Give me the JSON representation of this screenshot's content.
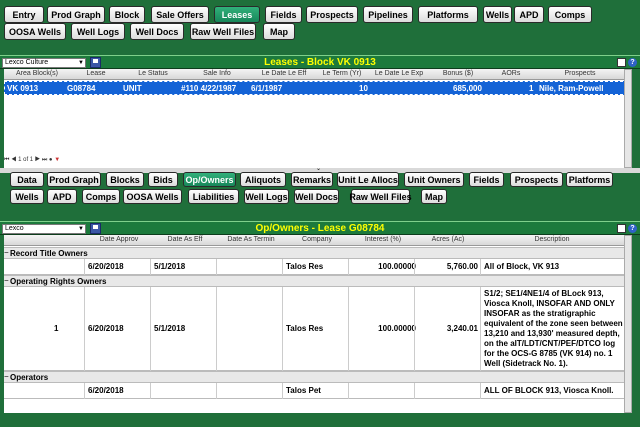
{
  "top_nav": [
    "Entry",
    "Prod Graph",
    "Block",
    "Sale Offers",
    "Leases",
    "Fields",
    "Prospects",
    "Pipelines",
    "Platforms",
    "Wells",
    "APD",
    "Comps",
    "OOSA Wells",
    "Well Logs",
    "Well Docs",
    "Raw Well Files",
    "Map"
  ],
  "top_active": "Leases",
  "leases_panel": {
    "selector": "Lexco Culture",
    "title": "Leases - Block VK 0913",
    "columns": [
      "Area Block(s)",
      "Lease",
      "Le Status",
      "Sale Info",
      "Le Date Le Eff",
      "Le Term (Yr)",
      "Le Date Le Exp",
      "Bonus ($)",
      "AORs",
      "Prospects"
    ],
    "row": {
      "area_block": "VK 0913",
      "lease": "G08784",
      "status": "UNIT",
      "sale_info": "#110 4/22/1987",
      "date_eff": "6/1/1987",
      "term": "10",
      "date_exp": "",
      "bonus": "685,000",
      "aors": "1",
      "prospects": "Nile, Ram-Powell"
    },
    "pager": "1 of 1"
  },
  "sub_nav": [
    "Data",
    "Prod Graph",
    "Blocks",
    "Bids",
    "Op/Owners",
    "Aliquots",
    "Remarks",
    "Unit Le Allocs",
    "Unit Owners",
    "Fields",
    "Prospects",
    "Platforms",
    "Wells",
    "APD",
    "Comps",
    "OOSA Wells",
    "Liabilities",
    "Well Logs",
    "Well Docs",
    "Raw Well Files",
    "Map"
  ],
  "sub_active": "Op/Owners",
  "owners_panel": {
    "selector": "Lexco",
    "title": "Op/Owners - Lease G08784",
    "columns": [
      "Date Approv",
      "Date As Eff",
      "Date As Termin",
      "Company",
      "Interest (%)",
      "Acres (Ac)",
      "Description"
    ],
    "groups": [
      {
        "name": "Record Title Owners",
        "rows": [
          {
            "num": "",
            "approv": "6/20/2018",
            "eff": "5/1/2018",
            "termin": "",
            "company": "Talos Res",
            "interest": "100.00000",
            "acres": "5,760.00",
            "description": [
              "All of Block, VK 913"
            ]
          }
        ]
      },
      {
        "name": "Operating Rights Owners",
        "rows": [
          {
            "num": "1",
            "approv": "6/20/2018",
            "eff": "5/1/2018",
            "termin": "",
            "company": "Talos Res",
            "interest": "100.00000",
            "acres": "3,240.01",
            "description": [
              "S1/2; SE1/4NE1/4 of BLock 913,",
              "Viosca Knoll, INSOFAR AND ONLY",
              "INSOFAR as the stratigraphic",
              "equivalent of the zone seen between",
              "13,210 and 13,930' measured depth,",
              "on the aIT/LDT/CNT/PEF/DTCO log",
              "for the OCS-G 8785 (VK 914) no. 1",
              "Well (Sidetrack No. 1)."
            ]
          }
        ]
      },
      {
        "name": "Operators",
        "rows": [
          {
            "num": "",
            "approv": "6/20/2018",
            "eff": "",
            "termin": "",
            "company": "Talos Pet",
            "interest": "",
            "acres": "",
            "description": [
              "ALL OF BLOCK 913, Viosca Knoll."
            ]
          }
        ]
      }
    ]
  }
}
